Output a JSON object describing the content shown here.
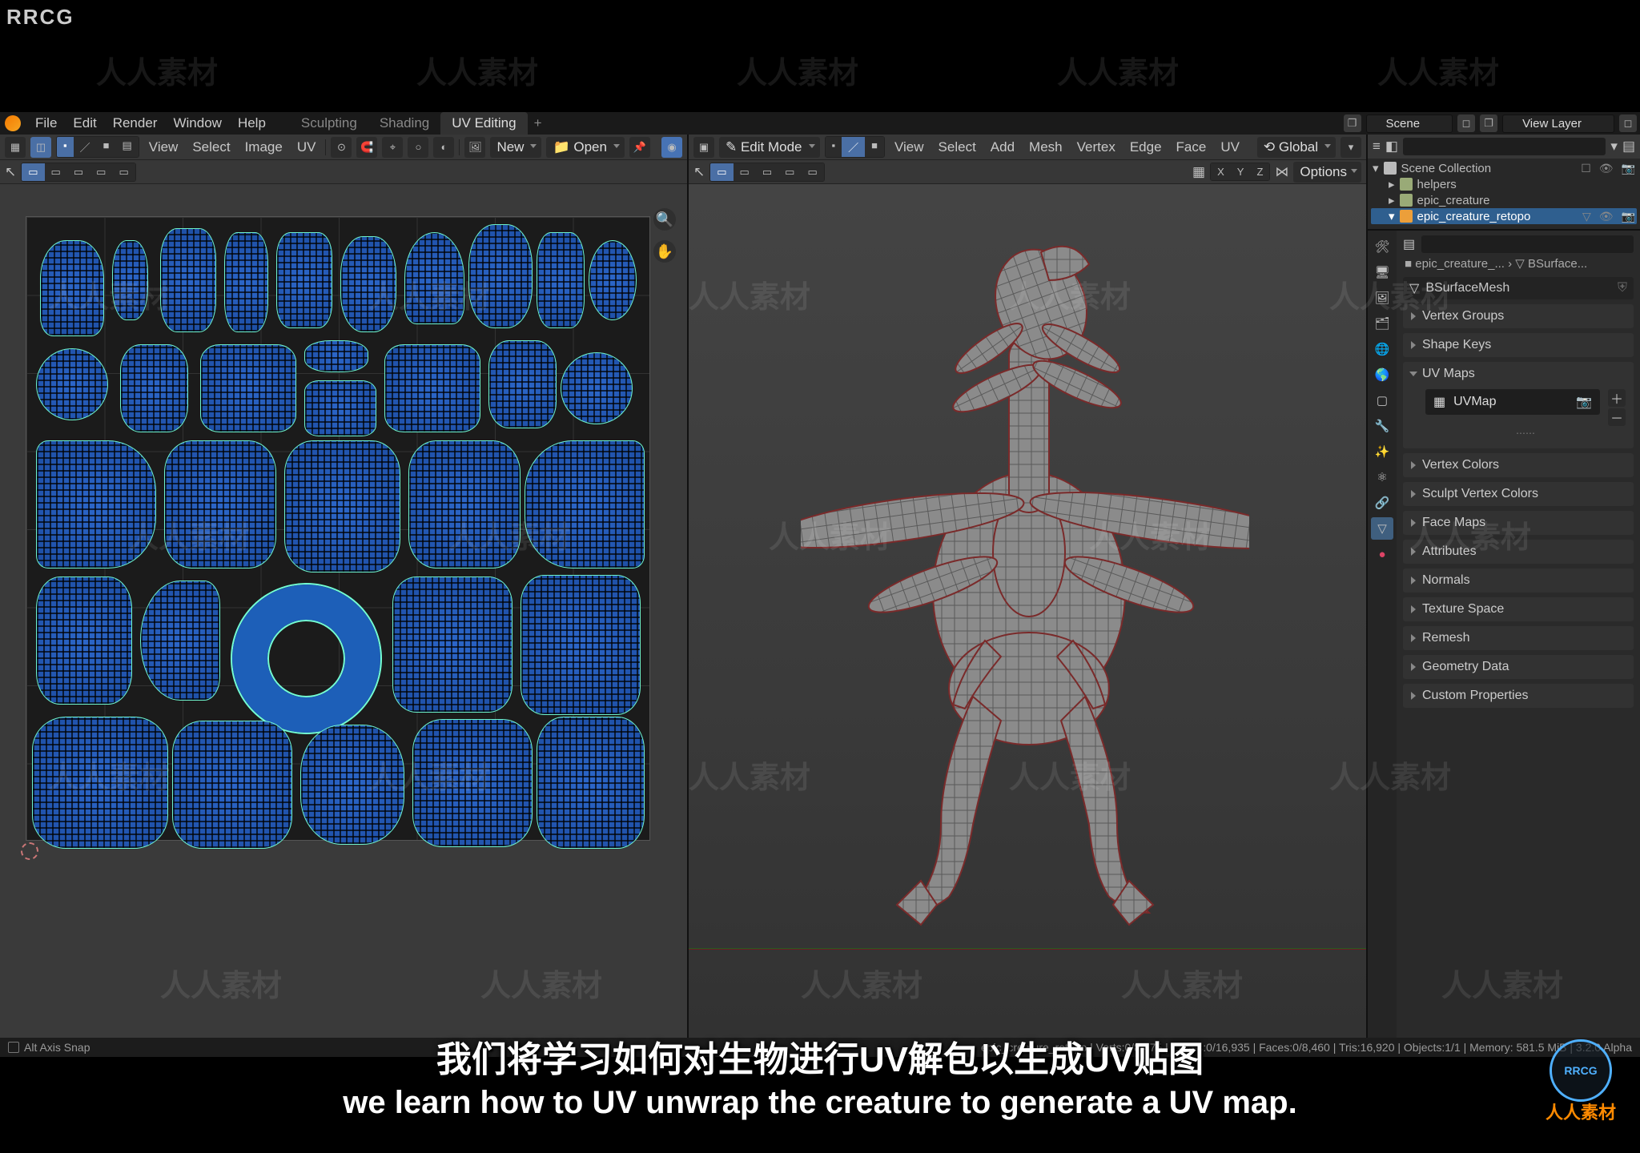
{
  "brand": "RRCG",
  "menubar": {
    "file": "File",
    "edit": "Edit",
    "render": "Render",
    "window": "Window",
    "help": "Help"
  },
  "workspace_tabs": {
    "sculpting": "Sculpting",
    "shading": "Shading",
    "uv_editing": "UV Editing"
  },
  "scene": {
    "label": "Scene",
    "viewlayer": "View Layer"
  },
  "uv_header": {
    "view": "View",
    "select": "Select",
    "image": "Image",
    "uv": "UV",
    "new": "New",
    "open": "Open"
  },
  "v3d_header": {
    "mode": "Edit Mode",
    "view": "View",
    "select": "Select",
    "add": "Add",
    "mesh": "Mesh",
    "vertex": "Vertex",
    "edge": "Edge",
    "face": "Face",
    "uv": "UV",
    "orientation": "Global",
    "options": "Options"
  },
  "gizmo_xyz": {
    "x": "X",
    "y": "Y",
    "z": "Z"
  },
  "outliner": {
    "scene": "Scene Collection",
    "items": [
      "helpers",
      "epic_creature",
      "epic_creature_retopo"
    ]
  },
  "properties": {
    "crumb_left": "epic_creature_...",
    "crumb_right": "BSurface...",
    "mesh": "BSurfaceMesh",
    "sections": {
      "vertex_groups": "Vertex Groups",
      "shape_keys": "Shape Keys",
      "uv_maps": "UV Maps",
      "vertex_colors": "Vertex Colors",
      "sculpt_vertex_colors": "Sculpt Vertex Colors",
      "face_maps": "Face Maps",
      "attributes": "Attributes",
      "normals": "Normals",
      "texture_space": "Texture Space",
      "remesh": "Remesh",
      "geometry_data": "Geometry Data",
      "custom_properties": "Custom Properties"
    },
    "uvmap_name": "UVMap"
  },
  "footer": {
    "left": "Alt   Axis Snap",
    "right": "epic_creature_retopo | Verts:0/8,475 | Edges:0/16,935 | Faces:0/8,460 | Tris:16,920 | Objects:1/1 | Memory: 581.5 MiB | 3.2.0 Alpha"
  },
  "subs": {
    "cn": "我们将学习如何对生物进行UV解包以生成UV贴图",
    "en": "we learn how to UV unwrap the creature to generate a UV map."
  },
  "badge": {
    "circ": "RRCG",
    "txt": "人人素材"
  }
}
